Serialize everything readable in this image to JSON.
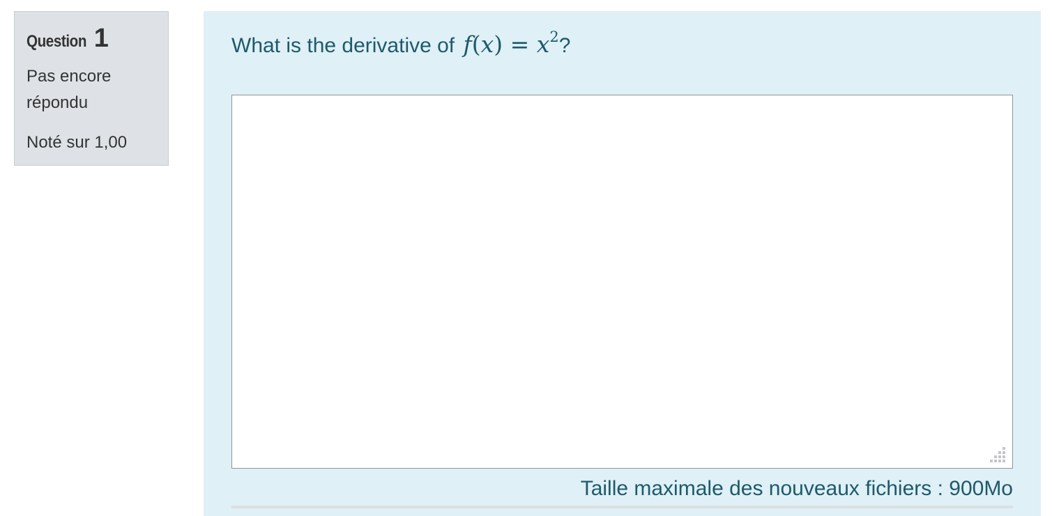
{
  "question_info": {
    "label": "Question",
    "number": "1",
    "state": "Pas encore répondu",
    "grade": "Noté sur 1,00"
  },
  "question": {
    "text": "What is the derivative of",
    "math": {
      "f": "f",
      "open": "(",
      "x": "x",
      "close": ")",
      "equals": "=",
      "base": "x",
      "exponent": "2"
    },
    "end": "?"
  },
  "answer_area": {
    "value": ""
  },
  "upload_limit": "Taille maximale des nouveaux fichiers : 900Mo",
  "colors": {
    "info_background": "#dee2e6",
    "content_background": "#dff0f6",
    "text_accent": "#1d5a6b"
  }
}
